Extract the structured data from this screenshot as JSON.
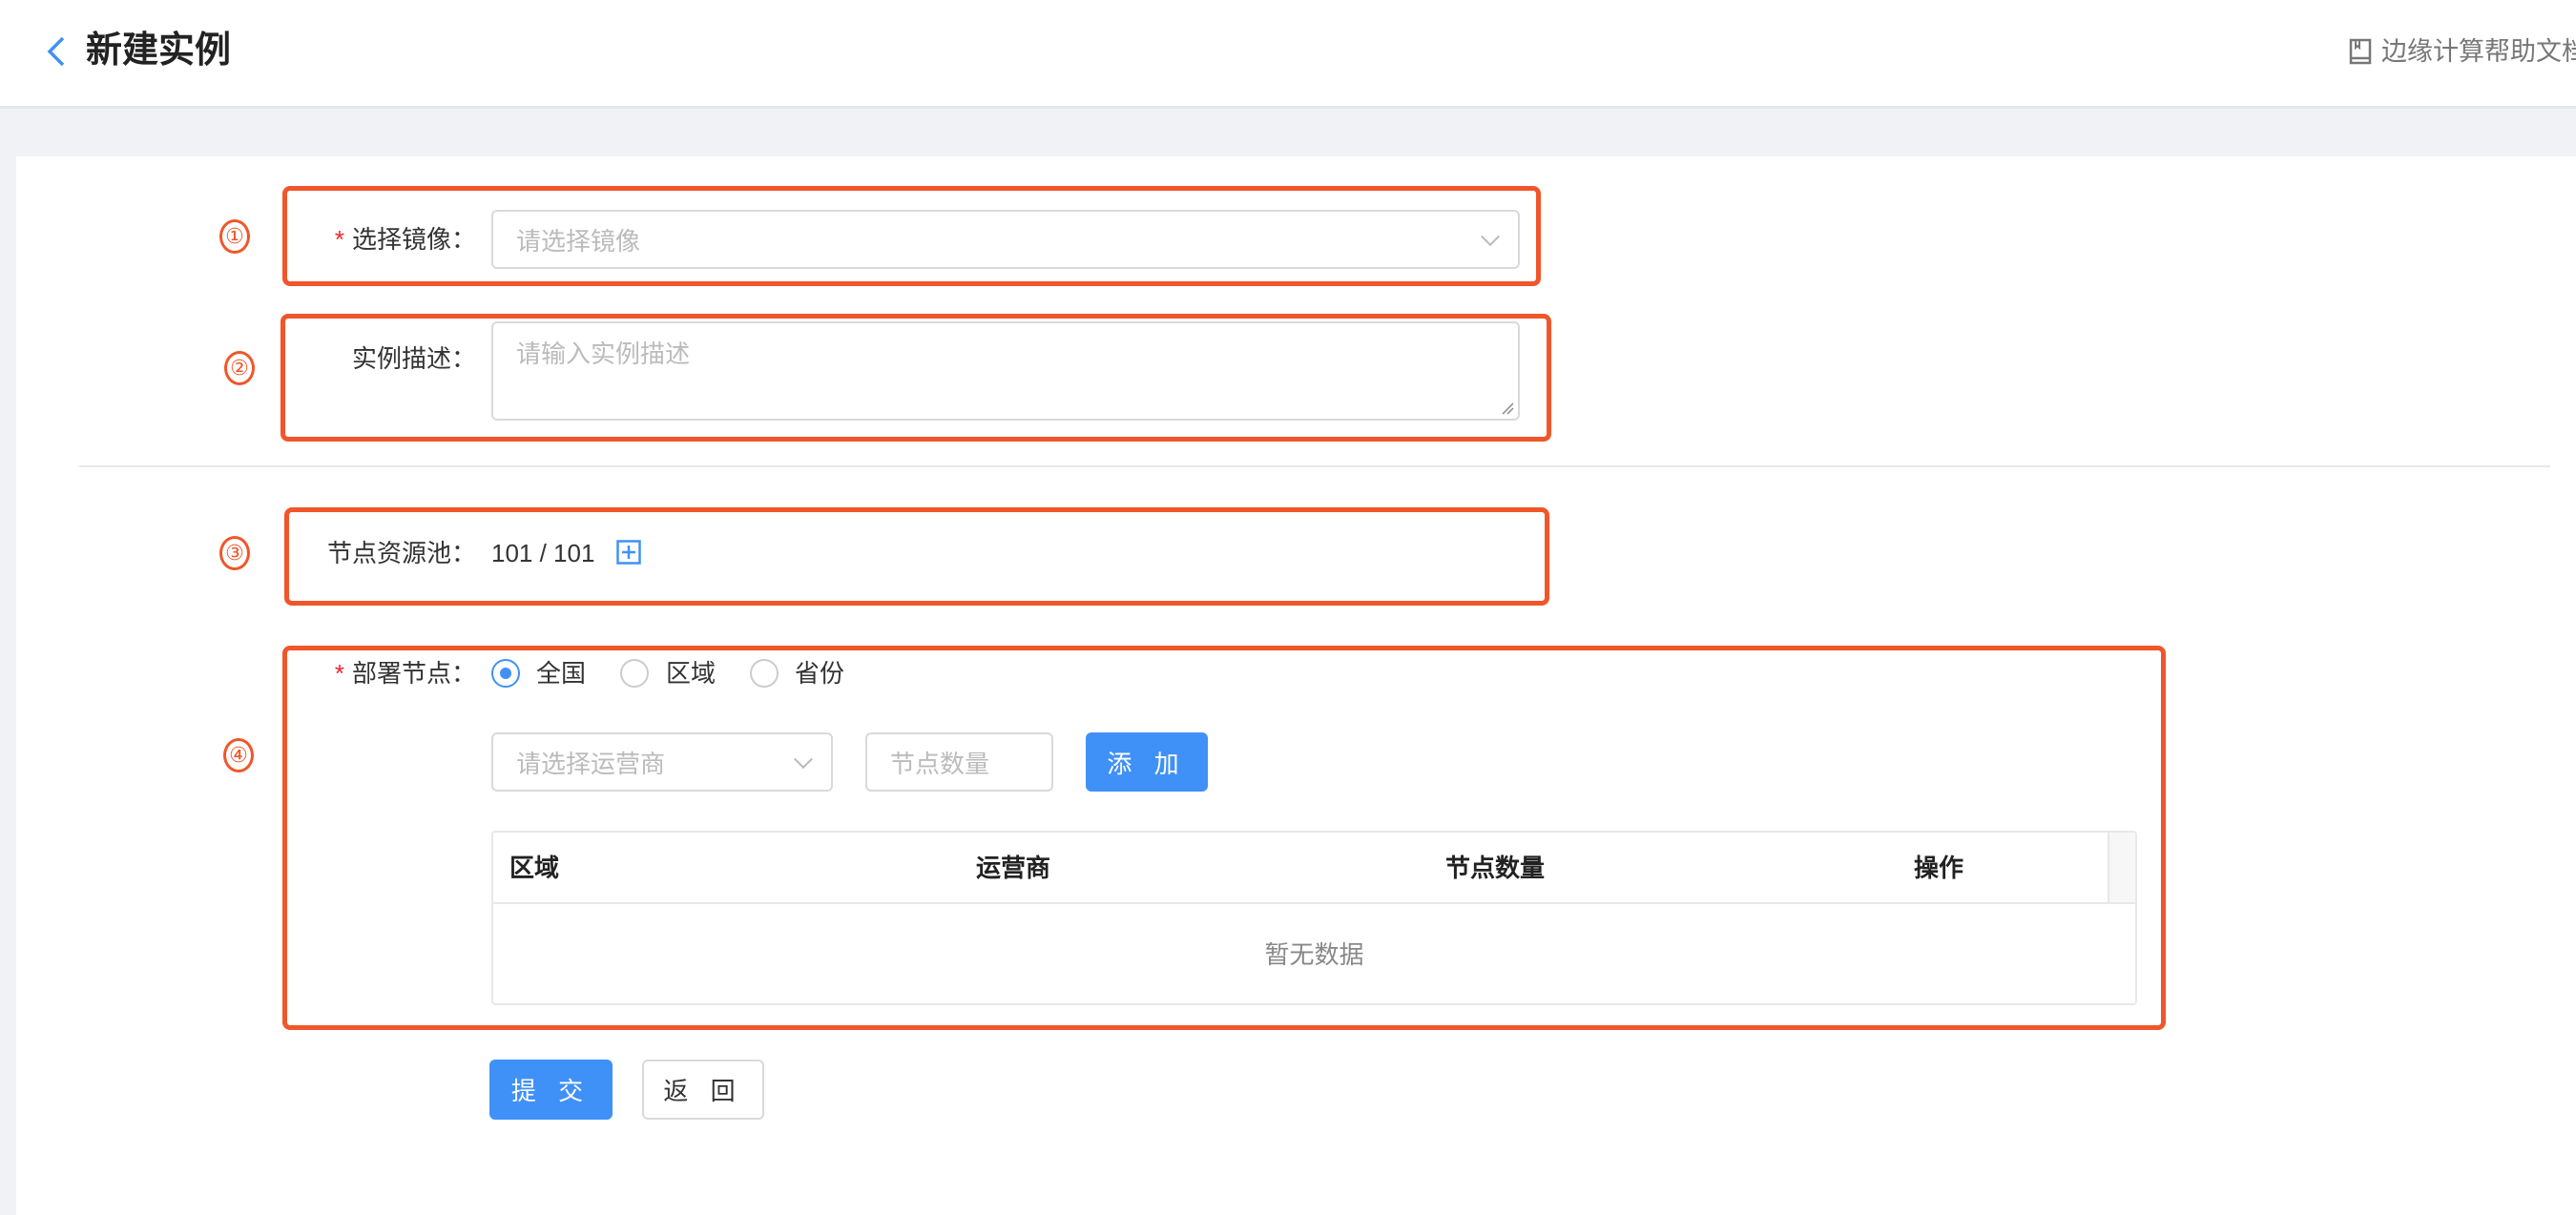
{
  "header": {
    "title": "新建实例",
    "help_link": "边缘计算帮助文档",
    "back_icon": "chevron-left-icon",
    "help_icon": "book-icon"
  },
  "annotations": [
    "①",
    "②",
    "③",
    "④"
  ],
  "form": {
    "image": {
      "label": "选择镜像：",
      "required": true,
      "placeholder": "请选择镜像"
    },
    "description": {
      "label": "实例描述：",
      "placeholder": "请输入实例描述"
    },
    "pool": {
      "label": "节点资源池：",
      "value": "101 / 101"
    },
    "deploy": {
      "label": "部署节点：",
      "required": true,
      "options": [
        {
          "label": "全国",
          "selected": true
        },
        {
          "label": "区域",
          "selected": false
        },
        {
          "label": "省份",
          "selected": false
        }
      ],
      "carrier_placeholder": "请选择运营商",
      "count_placeholder": "节点数量",
      "add_label": "添 加",
      "table": {
        "columns": [
          "区域",
          "运营商",
          "节点数量",
          "操作"
        ],
        "rows": [],
        "empty_text": "暂无数据"
      }
    }
  },
  "actions": {
    "submit": "提 交",
    "back": "返 回"
  },
  "colors": {
    "accent": "#4091f7",
    "annotation": "#f0562a",
    "required": "#f5222d"
  }
}
